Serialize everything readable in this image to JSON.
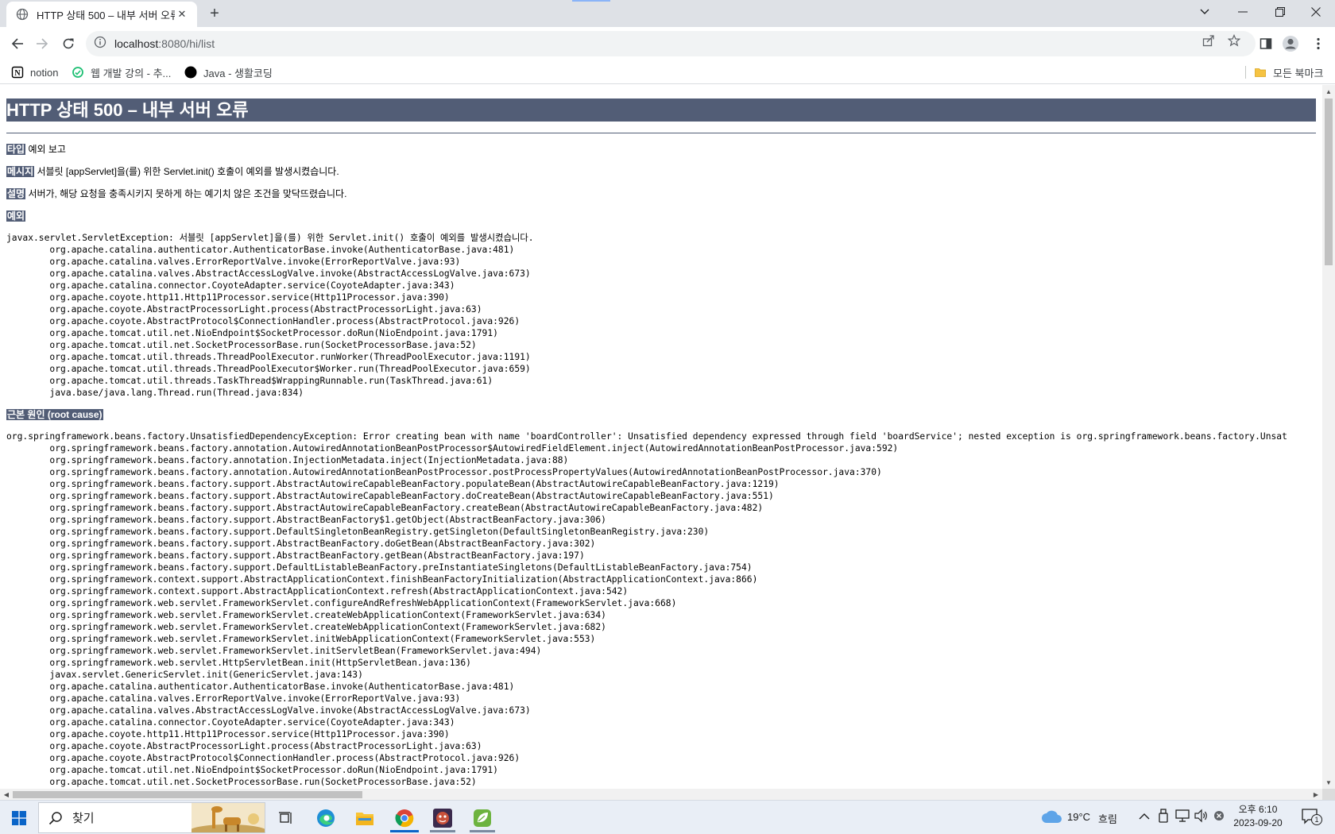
{
  "browser": {
    "tab_title": "HTTP 상태 500 – 내부 서버 오류",
    "url_host": "localhost",
    "url_path": ":8080/hi/list",
    "bookmarks": [
      {
        "label": "notion",
        "icon": "notion-icon"
      },
      {
        "label": "웹 개발 강의 - 추...",
        "icon": "lecture-site-icon"
      },
      {
        "label": "Java - 생활코딩",
        "icon": "opentutorials-icon"
      }
    ],
    "all_bookmarks": "모든 북마크"
  },
  "page": {
    "heading": "HTTP 상태 500 – 내부 서버 오류",
    "type_label": "타입",
    "type_value": "예외 보고",
    "message_label": "메시지",
    "message_value": "서블릿 [appServlet]을(를) 위한 Servlet.init() 호출이 예외를 발생시켰습니다.",
    "description_label": "설명",
    "description_value": "서버가, 해당 요청을 충족시키지 못하게 하는 예기치 않은 조건을 맞닥뜨렸습니다.",
    "exception_label": "예외",
    "exception_trace": "javax.servlet.ServletException: 서블릿 [appServlet]을(를) 위한 Servlet.init() 호출이 예외를 발생시켰습니다.\n\torg.apache.catalina.authenticator.AuthenticatorBase.invoke(AuthenticatorBase.java:481)\n\torg.apache.catalina.valves.ErrorReportValve.invoke(ErrorReportValve.java:93)\n\torg.apache.catalina.valves.AbstractAccessLogValve.invoke(AbstractAccessLogValve.java:673)\n\torg.apache.catalina.connector.CoyoteAdapter.service(CoyoteAdapter.java:343)\n\torg.apache.coyote.http11.Http11Processor.service(Http11Processor.java:390)\n\torg.apache.coyote.AbstractProcessorLight.process(AbstractProcessorLight.java:63)\n\torg.apache.coyote.AbstractProtocol$ConnectionHandler.process(AbstractProtocol.java:926)\n\torg.apache.tomcat.util.net.NioEndpoint$SocketProcessor.doRun(NioEndpoint.java:1791)\n\torg.apache.tomcat.util.net.SocketProcessorBase.run(SocketProcessorBase.java:52)\n\torg.apache.tomcat.util.threads.ThreadPoolExecutor.runWorker(ThreadPoolExecutor.java:1191)\n\torg.apache.tomcat.util.threads.ThreadPoolExecutor$Worker.run(ThreadPoolExecutor.java:659)\n\torg.apache.tomcat.util.threads.TaskThread$WrappingRunnable.run(TaskThread.java:61)\n\tjava.base/java.lang.Thread.run(Thread.java:834)",
    "root_cause_label": "근본 원인 (root cause)",
    "root_cause_trace": "org.springframework.beans.factory.UnsatisfiedDependencyException: Error creating bean with name 'boardController': Unsatisfied dependency expressed through field 'boardService'; nested exception is org.springframework.beans.factory.Unsat\n\torg.springframework.beans.factory.annotation.AutowiredAnnotationBeanPostProcessor$AutowiredFieldElement.inject(AutowiredAnnotationBeanPostProcessor.java:592)\n\torg.springframework.beans.factory.annotation.InjectionMetadata.inject(InjectionMetadata.java:88)\n\torg.springframework.beans.factory.annotation.AutowiredAnnotationBeanPostProcessor.postProcessPropertyValues(AutowiredAnnotationBeanPostProcessor.java:370)\n\torg.springframework.beans.factory.support.AbstractAutowireCapableBeanFactory.populateBean(AbstractAutowireCapableBeanFactory.java:1219)\n\torg.springframework.beans.factory.support.AbstractAutowireCapableBeanFactory.doCreateBean(AbstractAutowireCapableBeanFactory.java:551)\n\torg.springframework.beans.factory.support.AbstractAutowireCapableBeanFactory.createBean(AbstractAutowireCapableBeanFactory.java:482)\n\torg.springframework.beans.factory.support.AbstractBeanFactory$1.getObject(AbstractBeanFactory.java:306)\n\torg.springframework.beans.factory.support.DefaultSingletonBeanRegistry.getSingleton(DefaultSingletonBeanRegistry.java:230)\n\torg.springframework.beans.factory.support.AbstractBeanFactory.doGetBean(AbstractBeanFactory.java:302)\n\torg.springframework.beans.factory.support.AbstractBeanFactory.getBean(AbstractBeanFactory.java:197)\n\torg.springframework.beans.factory.support.DefaultListableBeanFactory.preInstantiateSingletons(DefaultListableBeanFactory.java:754)\n\torg.springframework.context.support.AbstractApplicationContext.finishBeanFactoryInitialization(AbstractApplicationContext.java:866)\n\torg.springframework.context.support.AbstractApplicationContext.refresh(AbstractApplicationContext.java:542)\n\torg.springframework.web.servlet.FrameworkServlet.configureAndRefreshWebApplicationContext(FrameworkServlet.java:668)\n\torg.springframework.web.servlet.FrameworkServlet.createWebApplicationContext(FrameworkServlet.java:634)\n\torg.springframework.web.servlet.FrameworkServlet.createWebApplicationContext(FrameworkServlet.java:682)\n\torg.springframework.web.servlet.FrameworkServlet.initWebApplicationContext(FrameworkServlet.java:553)\n\torg.springframework.web.servlet.FrameworkServlet.initServletBean(FrameworkServlet.java:494)\n\torg.springframework.web.servlet.HttpServletBean.init(HttpServletBean.java:136)\n\tjavax.servlet.GenericServlet.init(GenericServlet.java:143)\n\torg.apache.catalina.authenticator.AuthenticatorBase.invoke(AuthenticatorBase.java:481)\n\torg.apache.catalina.valves.ErrorReportValve.invoke(ErrorReportValve.java:93)\n\torg.apache.catalina.valves.AbstractAccessLogValve.invoke(AbstractAccessLogValve.java:673)\n\torg.apache.catalina.connector.CoyoteAdapter.service(CoyoteAdapter.java:343)\n\torg.apache.coyote.http11.Http11Processor.service(Http11Processor.java:390)\n\torg.apache.coyote.AbstractProcessorLight.process(AbstractProcessorLight.java:63)\n\torg.apache.coyote.AbstractProtocol$ConnectionHandler.process(AbstractProtocol.java:926)\n\torg.apache.tomcat.util.net.NioEndpoint$SocketProcessor.doRun(NioEndpoint.java:1791)\n\torg.apache.tomcat.util.net.SocketProcessorBase.run(SocketProcessorBase.java:52)"
  },
  "taskbar": {
    "search_placeholder": "찾기",
    "weather_temp": "19°C",
    "weather_desc": "흐림",
    "time": "오후 6:10",
    "date": "2023-09-20",
    "notification_count": "1"
  },
  "colors": {
    "tomcat_header": "#525d76",
    "chrome_tabstrip": "#dee1e6",
    "taskbar": "#e9eef6",
    "accent": "#0a64c8"
  }
}
